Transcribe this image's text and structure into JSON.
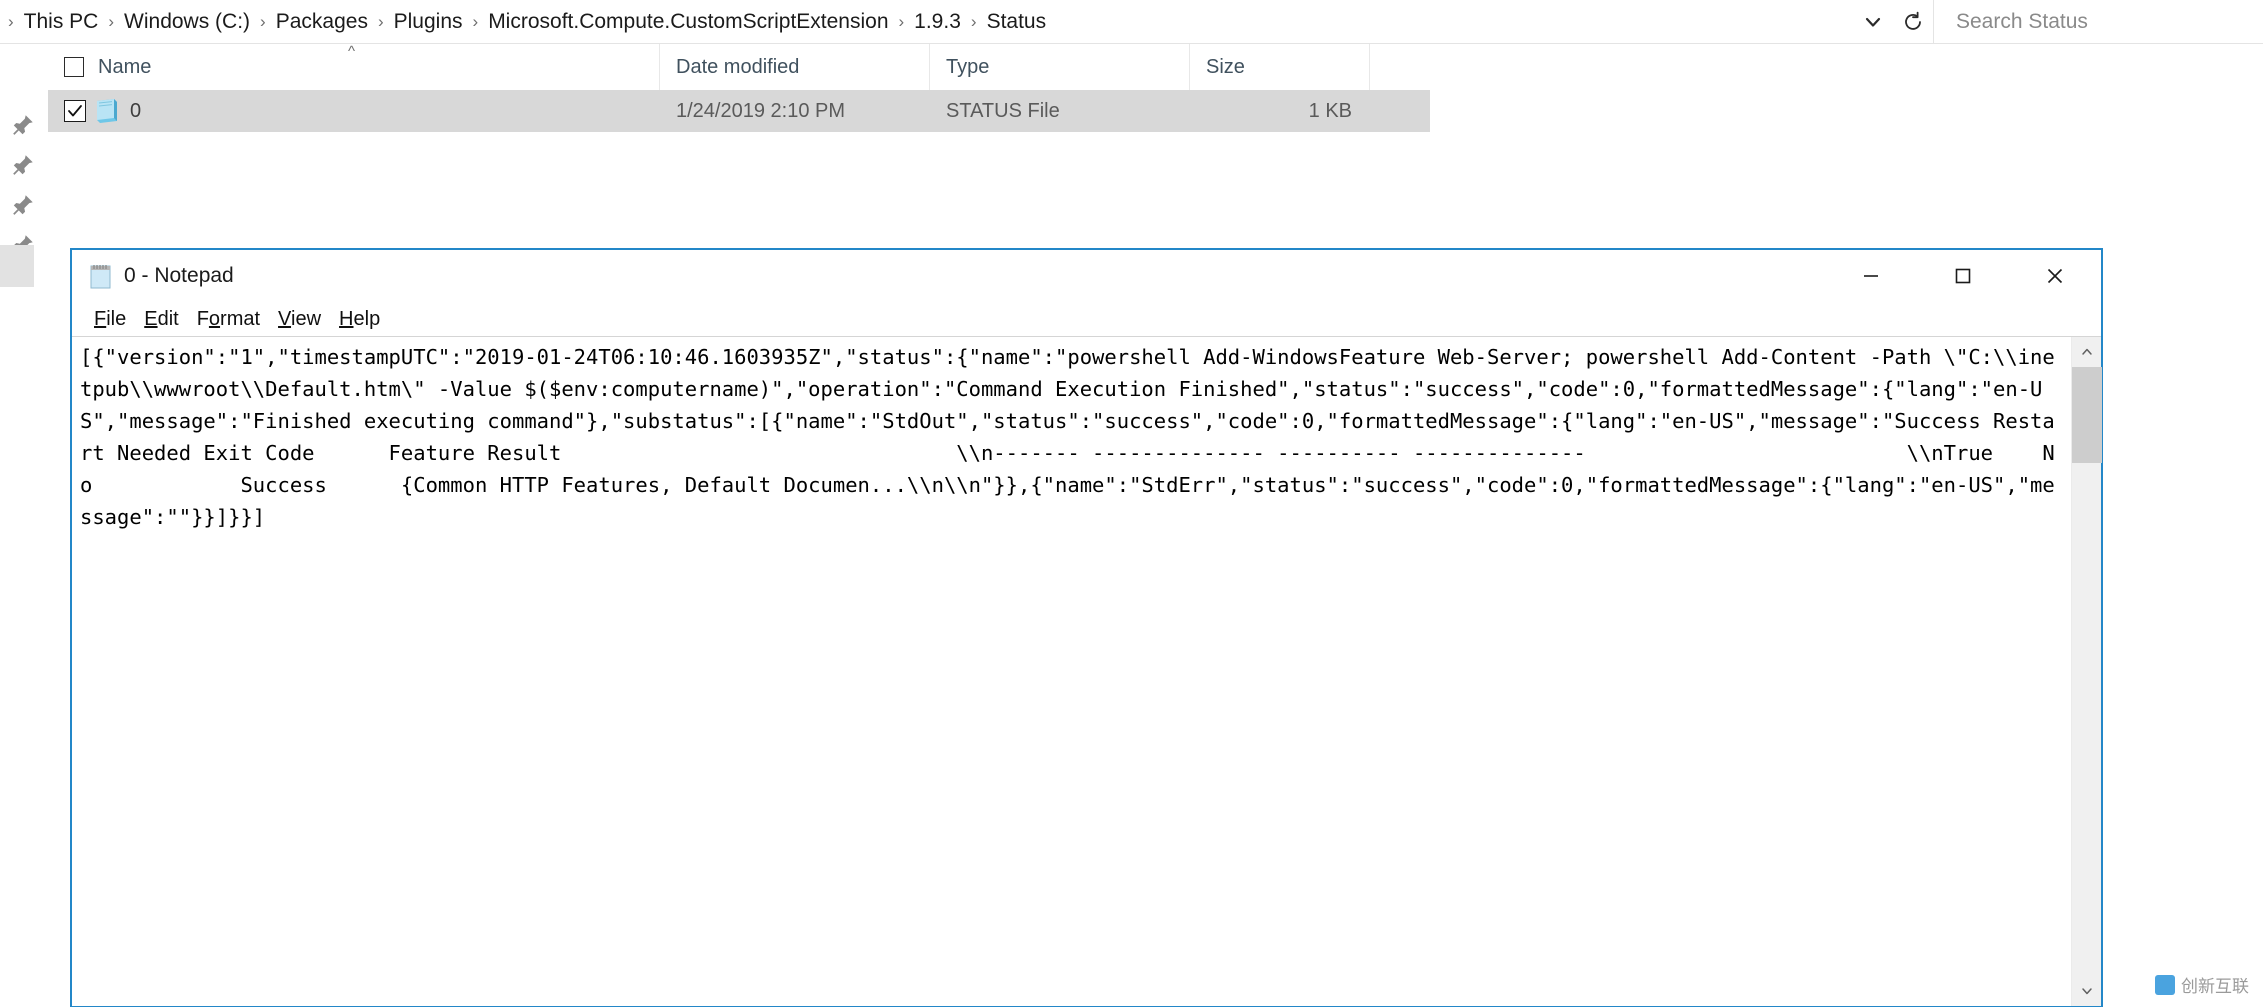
{
  "addressbar": {
    "breadcrumbs": [
      {
        "label": "This PC"
      },
      {
        "label": "Windows (C:)"
      },
      {
        "label": "Packages"
      },
      {
        "label": "Plugins"
      },
      {
        "label": "Microsoft.Compute.CustomScriptExtension"
      },
      {
        "label": "1.9.3"
      },
      {
        "label": "Status"
      }
    ],
    "separator": "›",
    "history_dropdown_icon": "chevron-down-icon",
    "refresh_icon": "refresh-icon",
    "search": {
      "placeholder": "Search Status",
      "icon": "search-icon"
    }
  },
  "filelist": {
    "columns": [
      {
        "key": "name",
        "label": "Name",
        "sort": "ascending",
        "sort_glyph": "^"
      },
      {
        "key": "date",
        "label": "Date modified"
      },
      {
        "key": "type",
        "label": "Type"
      },
      {
        "key": "size",
        "label": "Size"
      }
    ],
    "select_all_checked": false,
    "rows": [
      {
        "checked": true,
        "icon": "status-file-icon",
        "name": "0",
        "date": "1/24/2019 2:10 PM",
        "type": "STATUS File",
        "size": "1 KB",
        "selected": true
      }
    ]
  },
  "leftrail": {
    "pin_icon": "pin-icon",
    "pin_count": 4
  },
  "notepad": {
    "icon": "notepad-icon",
    "title": "0 - Notepad",
    "menu": [
      {
        "label": "File",
        "accel": "F"
      },
      {
        "label": "Edit",
        "accel": "E"
      },
      {
        "label": "Format",
        "accel": "o"
      },
      {
        "label": "View",
        "accel": "V"
      },
      {
        "label": "Help",
        "accel": "H"
      }
    ],
    "controls": {
      "minimize": "minimize-icon",
      "maximize": "maximize-icon",
      "close": "close-icon"
    },
    "scrollbar": {
      "up_glyph": "▲",
      "down_glyph": "▼"
    },
    "content": "[{\"version\":\"1\",\"timestampUTC\":\"2019-01-24T06:10:46.1603935Z\",\"status\":{\"name\":\"powershell Add-WindowsFeature Web-Server; powershell Add-Content -Path \\\"C:\\\\inetpub\\\\wwwroot\\\\Default.htm\\\" -Value $($env:computername)\",\"operation\":\"Command Execution Finished\",\"status\":\"success\",\"code\":0,\"formattedMessage\":{\"lang\":\"en-US\",\"message\":\"Finished executing command\"},\"substatus\":[{\"name\":\"StdOut\",\"status\":\"success\",\"code\":0,\"formattedMessage\":{\"lang\":\"en-US\",\"message\":\"Success Restart Needed Exit Code      Feature Result                                \\\\n------- -------------- ---------- --------------                          \\\\nTrue    No            Success      {Common HTTP Features, Default Documen...\\\\n\\\\n\"}},{\"name\":\"StdErr\",\"status\":\"success\",\"code\":0,\"formattedMessage\":{\"lang\":\"en-US\",\"message\":\"\"}}]}}]"
  },
  "watermark": {
    "text": "创新互联"
  },
  "colors": {
    "accent": "#2387c8",
    "selection": "#d8d8d8",
    "header_text": "#40515e",
    "close_hover": "#e81123"
  }
}
